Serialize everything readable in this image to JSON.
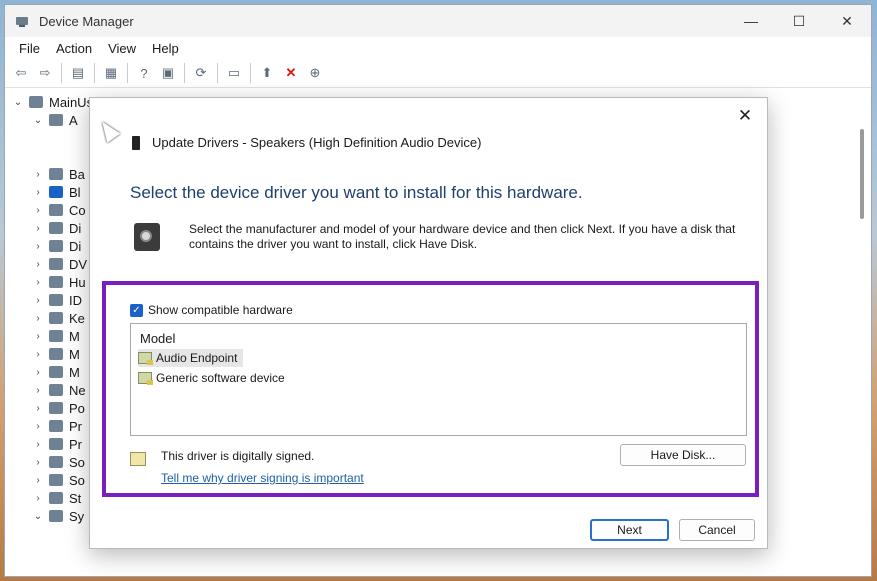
{
  "window": {
    "title": "Device Manager",
    "controls": {
      "minimize": "—",
      "maximize": "☐",
      "close": "✕"
    }
  },
  "menu": [
    "File",
    "Action",
    "View",
    "Help"
  ],
  "tree": {
    "root": "MainUser",
    "items": [
      "A",
      "Ba",
      "Bl",
      "Co",
      "Di",
      "Di",
      "DV",
      "Hu",
      "ID",
      "Ke",
      "M",
      "M",
      "M",
      "Ne",
      "Po",
      "Pr",
      "Pr",
      "So",
      "So",
      "St",
      "Sy"
    ]
  },
  "dialog": {
    "close": "✕",
    "header": "Update Drivers - Speakers (High Definition Audio Device)",
    "heading": "Select the device driver you want to install for this hardware.",
    "description": "Select the manufacturer and model of your hardware device and then click Next. If you have a disk that contains the driver you want to install, click Have Disk.",
    "show_compatible_label": "Show compatible hardware",
    "show_compatible_checked": true,
    "list_header": "Model",
    "models": [
      {
        "label": "Audio Endpoint",
        "selected": true
      },
      {
        "label": "Generic software device",
        "selected": false
      }
    ],
    "signed_text": "This driver is digitally signed.",
    "signing_link": "Tell me why driver signing is important",
    "have_disk": "Have Disk...",
    "next": "Next",
    "cancel": "Cancel"
  },
  "colors": {
    "highlight": "#7a1fbf",
    "heading": "#1f3f6e",
    "link": "#1f5fa8",
    "accent": "#1a62c6"
  }
}
